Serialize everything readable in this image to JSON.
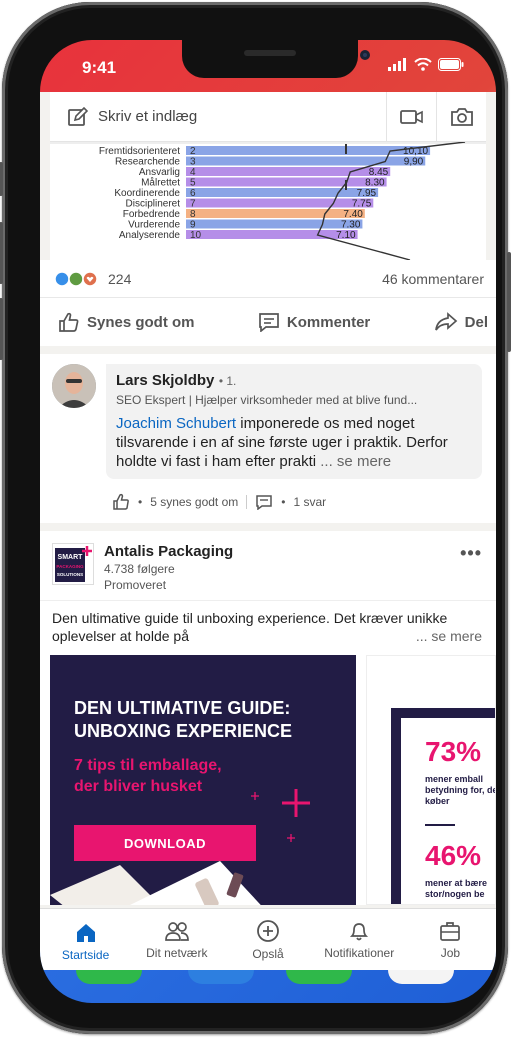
{
  "status": {
    "time": "9:41"
  },
  "composer": {
    "placeholder": "Skriv et indlæg",
    "video_icon": "video-icon",
    "camera_icon": "camera-icon"
  },
  "chart_data": {
    "type": "bar",
    "orientation": "horizontal",
    "categories": [
      "Fremtidsorienteret",
      "Researchende",
      "Ansvarlig",
      "Målrettet",
      "Koordinerende",
      "Disciplineret",
      "Forbedrende",
      "Vurderende",
      "Analyserende"
    ],
    "ranks": [
      "2",
      "3",
      "4",
      "5",
      "6",
      "7",
      "8",
      "9",
      "10"
    ],
    "values": [
      10.1,
      9.9,
      8.45,
      8.3,
      7.95,
      7.75,
      7.4,
      7.3,
      7.1
    ],
    "value_labels": [
      "10,10",
      "9,90",
      "8.45",
      "8.30",
      "7.95",
      "7.75",
      "7.40",
      "7.30",
      "7.10"
    ],
    "colors": [
      "#8aa4e6",
      "#8aa4e6",
      "#b58ee8",
      "#b58ee8",
      "#8aa4e6",
      "#b58ee8",
      "#f4b183",
      "#8aa4e6",
      "#b58ee8"
    ],
    "xlim": [
      0,
      12
    ]
  },
  "post": {
    "reaction_count": "224",
    "comments_count": "46 kommentarer",
    "actions": {
      "like": "Synes godt om",
      "comment": "Kommenter",
      "share": "Del"
    }
  },
  "comment": {
    "author": "Lars Skjoldby",
    "degree": "• 1.",
    "headline": "SEO Ekspert | Hjælper virksomheder med at blive fund...",
    "mention": "Joachim Schubert",
    "text": " imponerede os med noget tilsvarende i en af sine første uger i praktik. Derfor holdte vi fast i ham efter prakti",
    "more": "... se mere",
    "likes": "5 synes godt om",
    "replies": "1 svar",
    "bullet": "•"
  },
  "ad": {
    "company": "Antalis Packaging",
    "followers": "4.738 følgere",
    "promoted": "Promoveret",
    "logo_lines": [
      "SMART",
      "PACKAGING",
      "SOLUTIONS"
    ],
    "text": "Den ultimative guide til unboxing experience. Det kræver unikke oplevelser at holde på",
    "more": "... se mere",
    "slide1": {
      "title_line1": "DEN ULTIMATIVE GUIDE:",
      "title_line2": "UNBOXING EXPERIENCE",
      "subtitle_line1": "7 tips til emballage,",
      "subtitle_line2": "der bliver husket",
      "button": "DOWNLOAD"
    },
    "slide2": {
      "pct1": "73%",
      "text1": "mener emball betydning for, de køber",
      "pct2": "46%",
      "text2": "mener at bære stor/nogen be"
    }
  },
  "tabs": [
    {
      "label": "Startside",
      "icon": "home-icon",
      "active": true
    },
    {
      "label": "Dit netværk",
      "icon": "network-icon",
      "active": false
    },
    {
      "label": "Opslå",
      "icon": "post-icon",
      "active": false
    },
    {
      "label": "Notifikationer",
      "icon": "bell-icon",
      "active": false
    },
    {
      "label": "Job",
      "icon": "briefcase-icon",
      "active": false
    }
  ],
  "colors": {
    "brand_blue": "#0a66c2",
    "accent_pink": "#e8156f",
    "navy": "#221c45"
  }
}
